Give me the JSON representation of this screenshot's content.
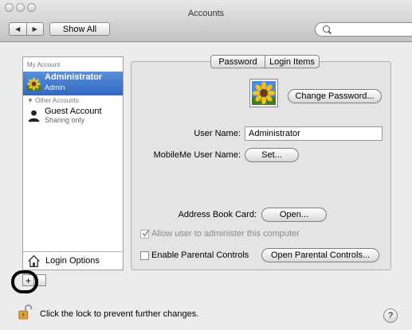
{
  "window": {
    "title": "Accounts"
  },
  "toolbar": {
    "back_glyph": "◀",
    "forward_glyph": "▶",
    "show_all_label": "Show All",
    "search_placeholder": ""
  },
  "sidebar": {
    "my_account_header": "My Account",
    "selected": {
      "name": "Administrator",
      "role": "Admin"
    },
    "other_accounts_header": "▼ Other Accounts",
    "others": [
      {
        "name": "Guest Account",
        "role": "Sharing only"
      }
    ],
    "login_options_label": "Login Options"
  },
  "add_remove": {
    "add": "+",
    "remove": ""
  },
  "tabs": [
    {
      "label": "Password"
    },
    {
      "label": "Login Items"
    }
  ],
  "password_pane": {
    "change_password_label": "Change Password...",
    "user_name_label": "User Name:",
    "user_name_value": "Administrator",
    "mobileme_label": "MobileMe User Name:",
    "set_label": "Set...",
    "address_book_label": "Address Book Card:",
    "open_label": "Open...",
    "allow_admin_label": "Allow user to administer this computer",
    "allow_admin_checked": true,
    "allow_admin_enabled": false,
    "parental_label": "Enable Parental Controls",
    "parental_checked": false,
    "open_parental_label": "Open Parental Controls..."
  },
  "footer": {
    "lock_text": "Click the lock to prevent further changes.",
    "help_glyph": "?"
  },
  "colors": {
    "selection": "#3a72c9",
    "panel": "#e4e4e4",
    "window": "#ececec"
  }
}
